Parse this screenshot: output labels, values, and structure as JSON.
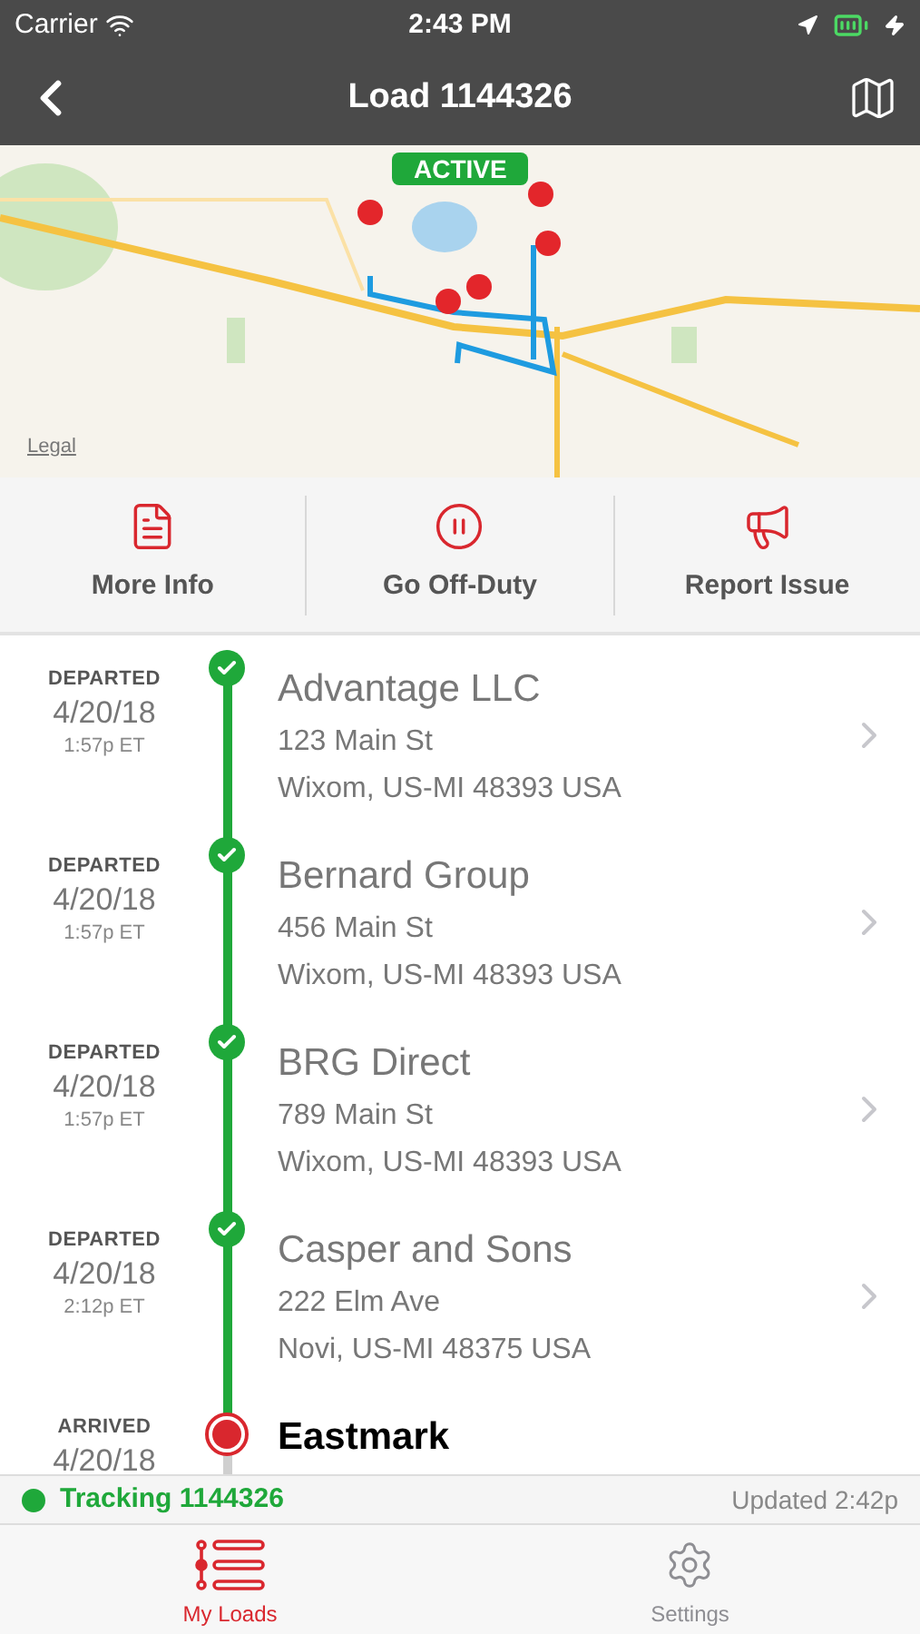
{
  "status_bar": {
    "carrier": "Carrier",
    "time": "2:43 PM"
  },
  "nav": {
    "title": "Load 1144326"
  },
  "map": {
    "badge": "ACTIVE",
    "legal": "Legal"
  },
  "actions": [
    {
      "label": "More Info",
      "kind": "info"
    },
    {
      "label": "Go Off-Duty",
      "kind": "pause"
    },
    {
      "label": "Report Issue",
      "kind": "megaphone"
    }
  ],
  "stops": [
    {
      "kind": "departed",
      "status": "DEPARTED",
      "date": "4/20/18",
      "time": "1:57p ET",
      "name": "Advantage LLC",
      "address": [
        "123 Main St",
        "Wixom, US-MI 48393 USA"
      ]
    },
    {
      "kind": "departed",
      "status": "DEPARTED",
      "date": "4/20/18",
      "time": "1:57p ET",
      "name": "Bernard Group",
      "address": [
        "456 Main St",
        "Wixom, US-MI 48393 USA"
      ]
    },
    {
      "kind": "departed",
      "status": "DEPARTED",
      "date": "4/20/18",
      "time": "1:57p ET",
      "name": "BRG Direct",
      "address": [
        "789 Main St",
        "Wixom, US-MI 48393 USA"
      ]
    },
    {
      "kind": "departed",
      "status": "DEPARTED",
      "date": "4/20/18",
      "time": "2:12p ET",
      "name": "Casper and Sons",
      "address": [
        "222 Elm Ave",
        "Novi, US-MI 48375 USA"
      ]
    },
    {
      "kind": "arrived",
      "status": "ARRIVED",
      "date": "4/20/18",
      "name": "Eastmark"
    }
  ],
  "tracking": {
    "label": "Tracking 1144326",
    "updated": "Updated 2:42p"
  },
  "tabs": [
    {
      "label": "My Loads",
      "kind": "loads",
      "selected": true
    },
    {
      "label": "Settings",
      "kind": "settings",
      "selected": false
    }
  ]
}
